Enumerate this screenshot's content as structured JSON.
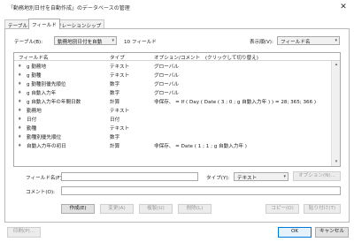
{
  "window": {
    "title": "「動務地別日付を自動作成」のデータベースの管理",
    "close": "✕"
  },
  "tabs": [
    "テーブル",
    "フィールド",
    "リレーションシップ"
  ],
  "toolbar": {
    "table_label": "テーブル(B):",
    "table_value": "動務地別日付を自動",
    "field_count": "10 フィールド",
    "sort_label": "表示順(V):",
    "sort_value": "フィールド名"
  },
  "list": {
    "columns": [
      "フィールド名",
      "タイプ",
      "オプション/コメント　(クリックして切り替え)"
    ],
    "rows": [
      {
        "name": "g 勤務地",
        "type": "テキスト",
        "option": "グローバル",
        "bullet": "♦"
      },
      {
        "name": "g 勤種",
        "type": "テキスト",
        "option": "グローバル",
        "bullet": "♦"
      },
      {
        "name": "g 勤種別優先順位",
        "type": "数字",
        "option": "グローバル",
        "bullet": "♦"
      },
      {
        "name": "g 自動入力年",
        "type": "数字",
        "option": "グローバル",
        "bullet": "♦"
      },
      {
        "name": "g 自動入力年の年間日数",
        "type": "計算",
        "option": "非保存、 = If ( Day ( Date ( 3 ; 0 ; g 自動入力年 ) ) = 28; 365; 366 )",
        "bullet": "♦"
      },
      {
        "name": "勤務地",
        "type": "テキスト",
        "option": "",
        "bullet": "♦"
      },
      {
        "name": "日付",
        "type": "日付",
        "option": "",
        "bullet": "♦"
      },
      {
        "name": "勤種",
        "type": "テキスト",
        "option": "",
        "bullet": "♦"
      },
      {
        "name": "勤種別優先順位",
        "type": "数字",
        "option": "",
        "bullet": "♦"
      },
      {
        "name": "自動入力年の初日",
        "type": "計算",
        "option": "非保存、 = Date ( 1 ; 1 ; g 自動入力年 )",
        "bullet": "♦"
      }
    ]
  },
  "form": {
    "field_name_label": "フィールド名(F):",
    "field_name_value": "",
    "type_label": "タイプ(Y):",
    "type_value": "テキスト",
    "options_button": "オプション(N)...",
    "comment_label": "コメント(O):",
    "comment_value": ""
  },
  "actions": {
    "create": "作成(E)",
    "change": "変更(A)",
    "duplicate": "複製(U)",
    "delete": "削除(L)",
    "copy": "コピー(O)",
    "paste": "貼り付け(T)"
  },
  "footer": {
    "print": "印刷(P)...",
    "ok": "OK",
    "cancel": "キャンセル"
  },
  "icons": {
    "dropdown": "▾",
    "scroll_up": "▴",
    "scroll_down": "▾"
  }
}
